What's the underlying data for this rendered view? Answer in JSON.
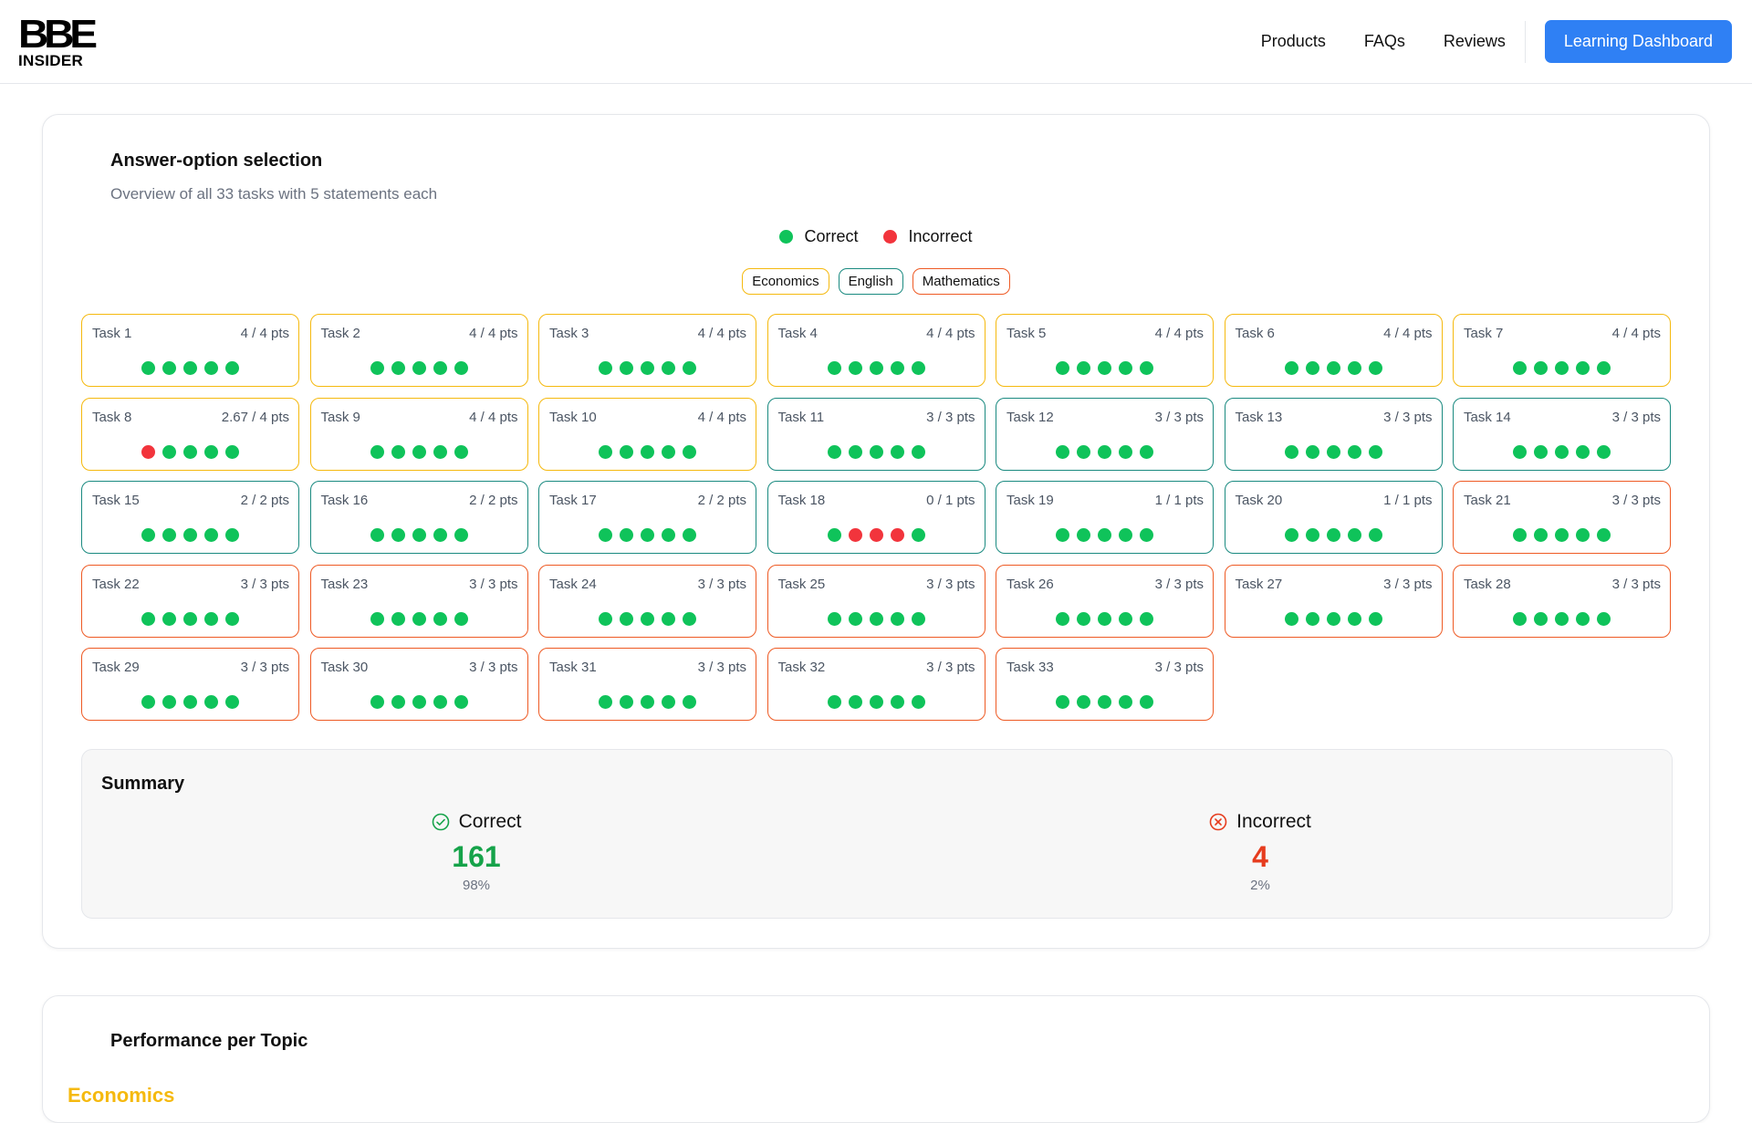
{
  "header": {
    "logo_mark": "BBE",
    "logo_sub": "INSIDER",
    "nav": [
      "Products",
      "FAQs",
      "Reviews"
    ],
    "cta_label": "Learning Dashboard"
  },
  "colors": {
    "correct": "#0fc35a",
    "incorrect": "#f2343c",
    "economics": "#f5b90f",
    "english": "#1a8a80",
    "mathematics": "#ee5a24",
    "cta": "#2f80f4"
  },
  "section1": {
    "title": "Answer-option selection",
    "subtitle": "Overview of all 33 tasks with 5 statements each",
    "legend": {
      "correct": "Correct",
      "incorrect": "Incorrect"
    },
    "tags": [
      {
        "label": "Economics",
        "subject": "economics"
      },
      {
        "label": "English",
        "subject": "english"
      },
      {
        "label": "Mathematics",
        "subject": "mathematics"
      }
    ],
    "tasks": [
      {
        "name": "Task 1",
        "pts": "4 / 4 pts",
        "subject": "economics",
        "dots": [
          1,
          1,
          1,
          1,
          1
        ]
      },
      {
        "name": "Task 2",
        "pts": "4 / 4 pts",
        "subject": "economics",
        "dots": [
          1,
          1,
          1,
          1,
          1
        ]
      },
      {
        "name": "Task 3",
        "pts": "4 / 4 pts",
        "subject": "economics",
        "dots": [
          1,
          1,
          1,
          1,
          1
        ]
      },
      {
        "name": "Task 4",
        "pts": "4 / 4 pts",
        "subject": "economics",
        "dots": [
          1,
          1,
          1,
          1,
          1
        ]
      },
      {
        "name": "Task 5",
        "pts": "4 / 4 pts",
        "subject": "economics",
        "dots": [
          1,
          1,
          1,
          1,
          1
        ]
      },
      {
        "name": "Task 6",
        "pts": "4 / 4 pts",
        "subject": "economics",
        "dots": [
          1,
          1,
          1,
          1,
          1
        ]
      },
      {
        "name": "Task 7",
        "pts": "4 / 4 pts",
        "subject": "economics",
        "dots": [
          1,
          1,
          1,
          1,
          1
        ]
      },
      {
        "name": "Task 8",
        "pts": "2.67 / 4 pts",
        "subject": "economics",
        "dots": [
          0,
          1,
          1,
          1,
          1
        ]
      },
      {
        "name": "Task 9",
        "pts": "4 / 4 pts",
        "subject": "economics",
        "dots": [
          1,
          1,
          1,
          1,
          1
        ]
      },
      {
        "name": "Task 10",
        "pts": "4 / 4 pts",
        "subject": "economics",
        "dots": [
          1,
          1,
          1,
          1,
          1
        ]
      },
      {
        "name": "Task 11",
        "pts": "3 / 3 pts",
        "subject": "english",
        "dots": [
          1,
          1,
          1,
          1,
          1
        ]
      },
      {
        "name": "Task 12",
        "pts": "3 / 3 pts",
        "subject": "english",
        "dots": [
          1,
          1,
          1,
          1,
          1
        ]
      },
      {
        "name": "Task 13",
        "pts": "3 / 3 pts",
        "subject": "english",
        "dots": [
          1,
          1,
          1,
          1,
          1
        ]
      },
      {
        "name": "Task 14",
        "pts": "3 / 3 pts",
        "subject": "english",
        "dots": [
          1,
          1,
          1,
          1,
          1
        ]
      },
      {
        "name": "Task 15",
        "pts": "2 / 2 pts",
        "subject": "english",
        "dots": [
          1,
          1,
          1,
          1,
          1
        ]
      },
      {
        "name": "Task 16",
        "pts": "2 / 2 pts",
        "subject": "english",
        "dots": [
          1,
          1,
          1,
          1,
          1
        ]
      },
      {
        "name": "Task 17",
        "pts": "2 / 2 pts",
        "subject": "english",
        "dots": [
          1,
          1,
          1,
          1,
          1
        ]
      },
      {
        "name": "Task 18",
        "pts": "0 / 1 pts",
        "subject": "english",
        "dots": [
          1,
          0,
          0,
          0,
          1
        ]
      },
      {
        "name": "Task 19",
        "pts": "1 / 1 pts",
        "subject": "english",
        "dots": [
          1,
          1,
          1,
          1,
          1
        ]
      },
      {
        "name": "Task 20",
        "pts": "1 / 1 pts",
        "subject": "english",
        "dots": [
          1,
          1,
          1,
          1,
          1
        ]
      },
      {
        "name": "Task 21",
        "pts": "3 / 3 pts",
        "subject": "mathematics",
        "dots": [
          1,
          1,
          1,
          1,
          1
        ]
      },
      {
        "name": "Task 22",
        "pts": "3 / 3 pts",
        "subject": "mathematics",
        "dots": [
          1,
          1,
          1,
          1,
          1
        ]
      },
      {
        "name": "Task 23",
        "pts": "3 / 3 pts",
        "subject": "mathematics",
        "dots": [
          1,
          1,
          1,
          1,
          1
        ]
      },
      {
        "name": "Task 24",
        "pts": "3 / 3 pts",
        "subject": "mathematics",
        "dots": [
          1,
          1,
          1,
          1,
          1
        ]
      },
      {
        "name": "Task 25",
        "pts": "3 / 3 pts",
        "subject": "mathematics",
        "dots": [
          1,
          1,
          1,
          1,
          1
        ]
      },
      {
        "name": "Task 26",
        "pts": "3 / 3 pts",
        "subject": "mathematics",
        "dots": [
          1,
          1,
          1,
          1,
          1
        ]
      },
      {
        "name": "Task 27",
        "pts": "3 / 3 pts",
        "subject": "mathematics",
        "dots": [
          1,
          1,
          1,
          1,
          1
        ]
      },
      {
        "name": "Task 28",
        "pts": "3 / 3 pts",
        "subject": "mathematics",
        "dots": [
          1,
          1,
          1,
          1,
          1
        ]
      },
      {
        "name": "Task 29",
        "pts": "3 / 3 pts",
        "subject": "mathematics",
        "dots": [
          1,
          1,
          1,
          1,
          1
        ]
      },
      {
        "name": "Task 30",
        "pts": "3 / 3 pts",
        "subject": "mathematics",
        "dots": [
          1,
          1,
          1,
          1,
          1
        ]
      },
      {
        "name": "Task 31",
        "pts": "3 / 3 pts",
        "subject": "mathematics",
        "dots": [
          1,
          1,
          1,
          1,
          1
        ]
      },
      {
        "name": "Task 32",
        "pts": "3 / 3 pts",
        "subject": "mathematics",
        "dots": [
          1,
          1,
          1,
          1,
          1
        ]
      },
      {
        "name": "Task 33",
        "pts": "3 / 3 pts",
        "subject": "mathematics",
        "dots": [
          1,
          1,
          1,
          1,
          1
        ]
      }
    ],
    "summary": {
      "title": "Summary",
      "correct_label": "Correct",
      "correct_count": "161",
      "correct_pct": "98%",
      "incorrect_label": "Incorrect",
      "incorrect_count": "4",
      "incorrect_pct": "2%"
    }
  },
  "section2": {
    "title": "Performance per Topic",
    "first_topic": "Economics"
  }
}
